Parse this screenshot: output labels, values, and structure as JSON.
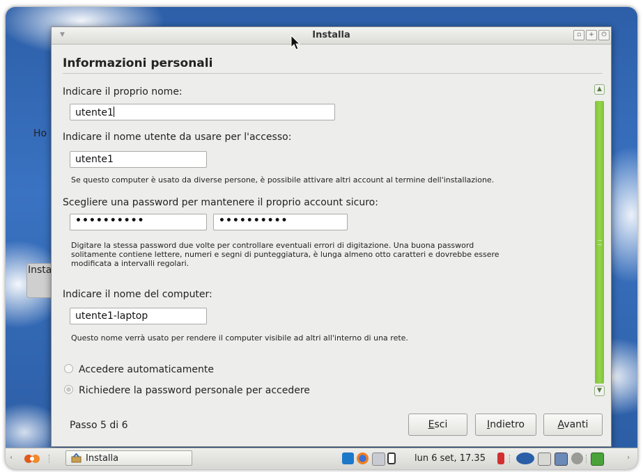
{
  "window": {
    "title": "Installa"
  },
  "page": {
    "heading": "Informazioni personali"
  },
  "background": {
    "label_ho": "Ho",
    "label_insta": "Insta"
  },
  "form": {
    "name_label": "Indicare il proprio nome:",
    "name_value": "utente1",
    "username_label": "Indicare il nome utente da usare per l'accesso:",
    "username_value": "utente1",
    "username_hint": "Se questo computer è usato da diverse persone, è possibile attivare altri account al termine dell'installazione.",
    "password_label": "Scegliere una password per mantenere il proprio account sicuro:",
    "password_value": "••••••••••",
    "password_confirm_value": "••••••••••",
    "password_hint_line1": "Digitare la stessa password due volte per controllare eventuali errori di digitazione. Una buona password",
    "password_hint_line2": "solitamente contiene lettere, numeri e segni di punteggiatura, è lunga almeno otto caratteri e dovrebbe essere",
    "password_hint_line3": "modificata a intervalli regolari.",
    "computer_label": "Indicare il nome del computer:",
    "computer_value": "utente1-laptop",
    "computer_hint": "Questo nome verrà usato per rendere il computer visibile ad altri all'interno di una rete.",
    "radio_auto_login": "Accedere automaticamente",
    "radio_require_password": "Richiedere la password personale per accedere",
    "selected_option": "Richiedere la password personale per accedere"
  },
  "footer": {
    "step": "Passo 5 di 6",
    "quit_mnemonic": "E",
    "quit_rest": "sci",
    "back_mnemonic": "I",
    "back_rest": "ndietro",
    "forward_mnemonic": "A",
    "forward_rest": "vanti"
  },
  "taskbar": {
    "task_label": "Installa",
    "clock": "lun  6 set, 17.35",
    "icons": [
      "mint-menu-icon",
      "installer-icon",
      "skype-icon",
      "firefox-icon",
      "screenshot-icon",
      "network-icon",
      "volume-icon",
      "wifi-radar-icon",
      "clipboard-icon",
      "display-icon",
      "power-icon",
      "update-icon"
    ]
  },
  "colors": {
    "scrollbar_accent": "#8acb44",
    "window_bg": "#ededeb",
    "desktop_sky": "#3a73c2"
  }
}
